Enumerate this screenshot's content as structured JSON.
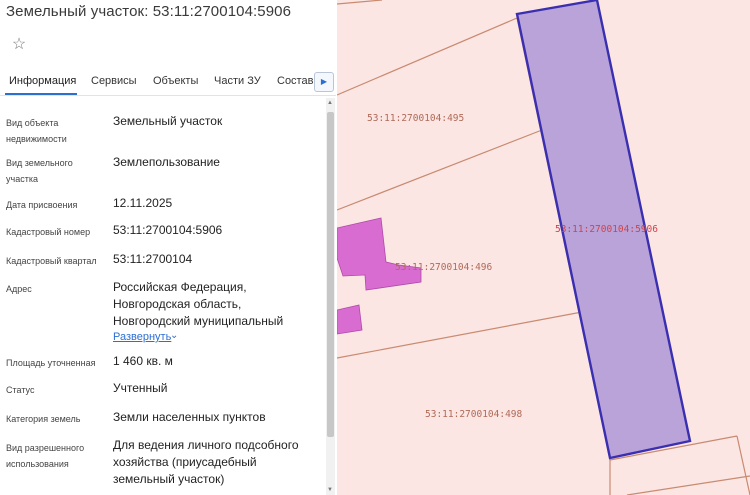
{
  "panel": {
    "title": "Земельный участок: 53:11:2700104:5906",
    "favorite_icon": "star-outline-icon",
    "tabs": [
      {
        "label": "Информация",
        "active": true
      },
      {
        "label": "Сервисы",
        "active": false
      },
      {
        "label": "Объекты",
        "active": false
      },
      {
        "label": "Части ЗУ",
        "active": false
      },
      {
        "label": "Состав",
        "active": false
      }
    ],
    "tabs_next_icon": "chevron-right-icon",
    "fields": [
      {
        "label": "Вид объекта недвижимости",
        "value": "Земельный участок"
      },
      {
        "label": "Вид земельного участка",
        "value": "Землепользование"
      },
      {
        "label": "Дата присвоения",
        "value": "12.11.2025"
      },
      {
        "label": "Кадастровый номер",
        "value": "53:11:2700104:5906"
      },
      {
        "label": "Кадастровый квартал",
        "value": "53:11:2700104"
      },
      {
        "label": "Адрес",
        "value": "Российская Федерация, Новгородская область, Новгородский муниципальный"
      },
      {
        "label": "Площадь уточненная",
        "value": "1 460 кв. м"
      },
      {
        "label": "Статус",
        "value": "Учтенный"
      },
      {
        "label": "Категория земель",
        "value": "Земли населенных пунктов"
      },
      {
        "label": "Вид разрешенного использования",
        "value": "Для ведения личного подсобного хозяйства (приусадебный земельный участок)"
      }
    ],
    "expand_label": "Развернуть",
    "expand_icon": "chevron-down-icon"
  },
  "map": {
    "parcel_labels": {
      "p495": "53:11:2700104:495",
      "p496": "53:11:2700104:496",
      "p498": "53:11:2700104:498",
      "selected": "53:11:2700104:5906"
    },
    "colors": {
      "background": "#fbe6e4",
      "boundary": "#c98a70",
      "selected_fill": "#b9a3d8",
      "selected_stroke": "#3a2fb0",
      "building_fill": "#d96cd0",
      "link": "#2d6fd1"
    }
  }
}
